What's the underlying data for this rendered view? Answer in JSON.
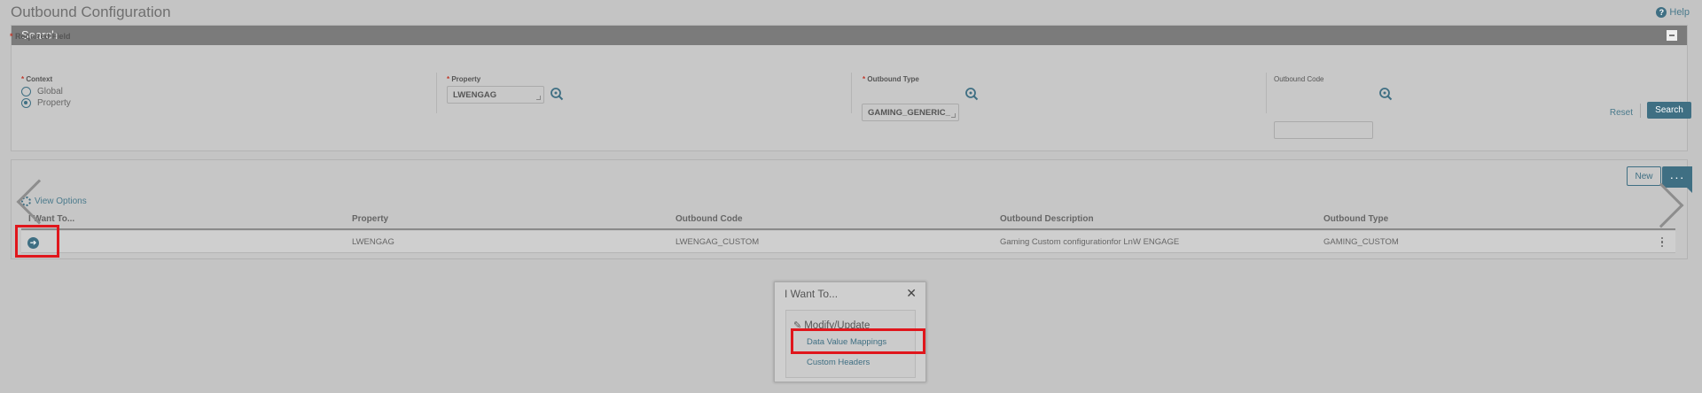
{
  "page": {
    "title": "Outbound Configuration",
    "help_label": "Help"
  },
  "search": {
    "header": "Search",
    "required_note": "Required Field",
    "context": {
      "label": "Context",
      "options": [
        {
          "label": "Global",
          "selected": false
        },
        {
          "label": "Property",
          "selected": true
        }
      ]
    },
    "property": {
      "label": "Property",
      "value": "LWENGAG"
    },
    "outbound_type": {
      "label": "Outbound Type",
      "value": "GAMING_GENERIC_"
    },
    "outbound_code": {
      "label": "Outbound Code",
      "value": ""
    },
    "reset_label": "Reset",
    "search_label": "Search"
  },
  "results": {
    "new_label": "New",
    "more_label": "···",
    "view_options_label": "View Options",
    "columns": [
      "I Want To...",
      "Property",
      "Outbound Code",
      "Outbound Description",
      "Outbound Type"
    ],
    "rows": [
      {
        "property": "LWENGAG",
        "outbound_code": "LWENGAG_CUSTOM",
        "outbound_description": "Gaming Custom configurationfor LnW ENGAGE",
        "outbound_type": "GAMING_CUSTOM"
      }
    ]
  },
  "popup": {
    "title": "I Want To...",
    "close_label": "✕",
    "section_label": "Modify/Update",
    "items": [
      "Data Value Mappings",
      "Custom Headers"
    ]
  },
  "colors": {
    "accent": "#3f6f83",
    "highlight": "#e0161c",
    "background": "#c4c4c4"
  }
}
